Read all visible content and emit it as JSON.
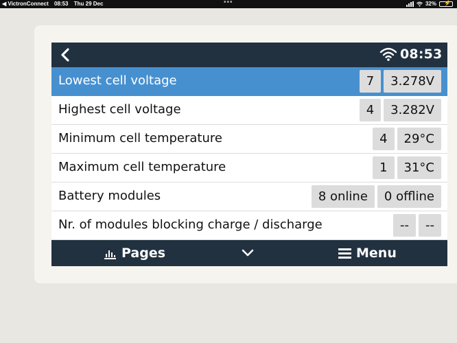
{
  "statusbar": {
    "back_app": "◀ VictronConnect",
    "time": "08:53",
    "date": "Thu 29 Dec",
    "battery_percent": "32%",
    "battery_level": 0.32
  },
  "header": {
    "clock": "08:53"
  },
  "rows": [
    {
      "label": "Lowest cell voltage",
      "values": [
        "7",
        "3.278V"
      ],
      "selected": true
    },
    {
      "label": "Highest cell voltage",
      "values": [
        "4",
        "3.282V"
      ],
      "selected": false
    },
    {
      "label": "Minimum cell temperature",
      "values": [
        "4",
        "29°C"
      ],
      "selected": false
    },
    {
      "label": "Maximum cell temperature",
      "values": [
        "1",
        "31°C"
      ],
      "selected": false
    },
    {
      "label": "Battery modules",
      "values": [
        "8 online",
        "0 offline"
      ],
      "selected": false
    },
    {
      "label": "Nr. of modules blocking charge / discharge",
      "values": [
        "--",
        "--"
      ],
      "selected": false
    }
  ],
  "footer": {
    "pages_label": "Pages",
    "menu_label": "Menu"
  },
  "colors": {
    "header_bg": "#213140",
    "selected_bg": "#4790d0",
    "value_bg": "#dcdcdc"
  },
  "icons": [
    "back-chevron-icon",
    "wifi-icon",
    "bar-chart-icon",
    "chevron-down-icon",
    "hamburger-menu-icon"
  ]
}
